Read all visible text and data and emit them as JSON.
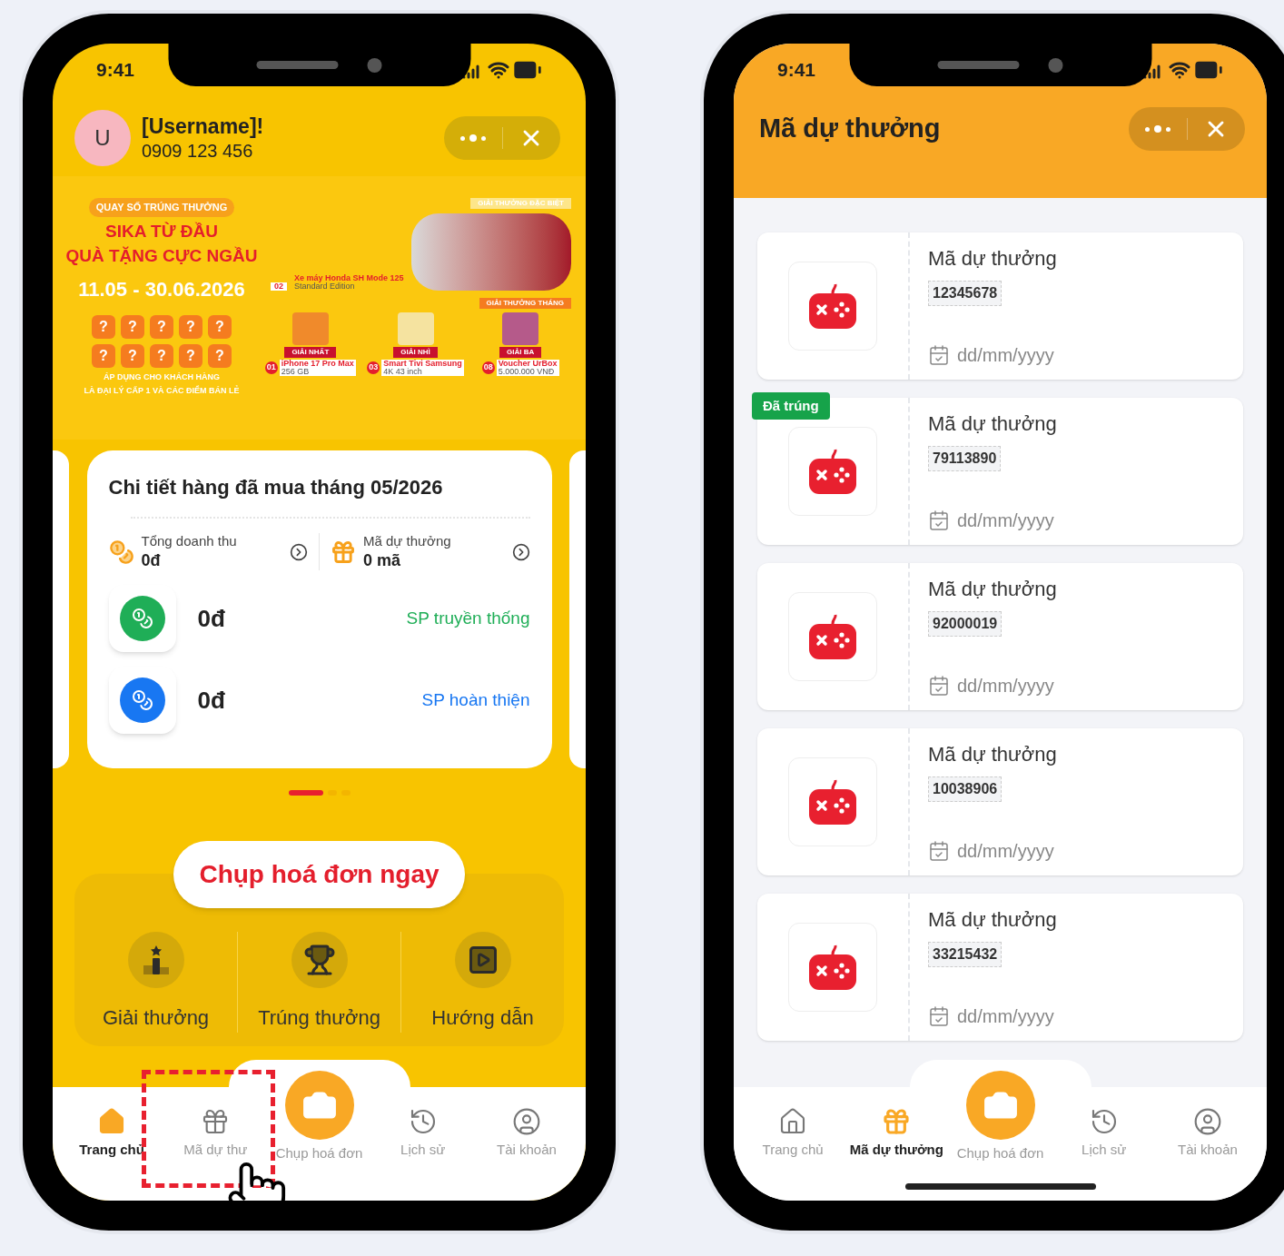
{
  "home_screen": {
    "status_time": "9:41",
    "user": {
      "avatar_letter": "U",
      "name": "[Username]!",
      "phone": "0909 123 456"
    },
    "banner": {
      "tag": "QUAY SỐ TRÚNG THƯỞNG",
      "title_lines": [
        "SIKA TỪ ĐẦU",
        "QUÀ TẶNG CỰC NGẦU"
      ],
      "dates": "11.05 - 30.06.2026",
      "tiles": [
        "?",
        "?",
        "?",
        "?",
        "?",
        "?",
        "?",
        "?",
        "?",
        "?"
      ],
      "note_lines": [
        "ÁP DỤNG CHO KHÁCH HÀNG",
        "LÀ ĐẠI LÝ CẤP 1 VÀ CÁC ĐIỂM BÁN LẺ"
      ],
      "special_heading": "GIẢI THƯỞNG ĐẶC BIỆT",
      "monthly_heading": "GIẢI THƯỞNG THÁNG",
      "special_prize": {
        "rank": "02",
        "name": "Xe máy Honda SH Mode 125",
        "detail": "Standard Edition"
      },
      "prizes": [
        {
          "rank": "01",
          "label": "GIẢI NHẤT",
          "name": "iPhone 17 Pro Max",
          "detail": "256 GB",
          "kind": "phone"
        },
        {
          "rank": "03",
          "label": "GIẢI NHÌ",
          "name": "Smart Tivi Samsung",
          "detail": "4K 43 inch",
          "kind": "tv"
        },
        {
          "rank": "08",
          "label": "GIẢI BA",
          "name": "Voucher UrBox",
          "detail": "5.000.000 VNĐ",
          "kind": "voucher"
        }
      ]
    },
    "summary": {
      "title": "Chi tiết hàng đã mua tháng 05/2026",
      "stats": [
        {
          "label": "Tổng doanh thu",
          "value": "0đ",
          "kind": "revenue"
        },
        {
          "label": "Mã dự thưởng",
          "value": "0 mã",
          "kind": "codes"
        }
      ],
      "lines": [
        {
          "amount": "0đ",
          "label": "SP truyền thống",
          "color": "#1fae57"
        },
        {
          "amount": "0đ",
          "label": "SP hoàn thiện",
          "color": "#1877f2"
        }
      ]
    },
    "dots": [
      {
        "selected": true
      },
      {
        "selected": false
      },
      {
        "selected": false
      }
    ],
    "cta": "Chụp hoá đơn ngay",
    "shortcuts": [
      {
        "label": "Giải thưởng",
        "kind": "podium"
      },
      {
        "label": "Trúng thưởng",
        "kind": "trophy"
      },
      {
        "label": "Hướng dẫn",
        "kind": "video"
      }
    ],
    "nav": [
      {
        "label": "Trang chủ",
        "kind": "home",
        "selected": true
      },
      {
        "label": "Mã dự thư",
        "kind": "gift",
        "selected": false
      },
      {
        "label": "Chụp hoá đơn",
        "kind": "camera",
        "selected": false
      },
      {
        "label": "Lịch sử",
        "kind": "history",
        "selected": false
      },
      {
        "label": "Tài khoản",
        "kind": "account",
        "selected": false
      }
    ]
  },
  "codes_screen": {
    "status_time": "9:41",
    "title": "Mã dự thưởng",
    "tickets": [
      {
        "title": "Mã dự thưởng",
        "code": "12345678",
        "date": "dd/mm/yyyy",
        "won": false
      },
      {
        "title": "Mã dự thưởng",
        "code": "79113890",
        "date": "dd/mm/yyyy",
        "won": true,
        "badge": "Đã trúng"
      },
      {
        "title": "Mã dự thưởng",
        "code": "92000019",
        "date": "dd/mm/yyyy",
        "won": false
      },
      {
        "title": "Mã dự thưởng",
        "code": "10038906",
        "date": "dd/mm/yyyy",
        "won": false
      },
      {
        "title": "Mã dự thưởng",
        "code": "33215432",
        "date": "dd/mm/yyyy",
        "won": false
      }
    ],
    "nav": [
      {
        "label": "Trang chủ",
        "kind": "home",
        "selected": false
      },
      {
        "label": "Mã dự thưởng",
        "kind": "gift",
        "selected": true
      },
      {
        "label": "Chụp hoá đơn",
        "kind": "camera",
        "selected": false
      },
      {
        "label": "Lịch sử",
        "kind": "history",
        "selected": false
      },
      {
        "label": "Tài khoản",
        "kind": "account",
        "selected": false
      }
    ]
  }
}
